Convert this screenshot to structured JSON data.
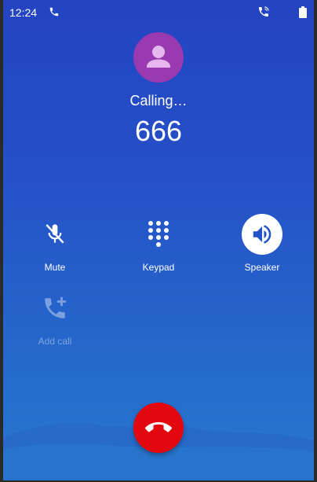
{
  "status_bar": {
    "time": "12:24",
    "icons": [
      "phone-icon",
      "wifi-calling-icon",
      "battery-icon"
    ]
  },
  "call": {
    "status": "Calling…",
    "number": "666"
  },
  "actions": {
    "mute": {
      "label": "Mute",
      "icon": "mic-off-icon"
    },
    "keypad": {
      "label": "Keypad",
      "icon": "dialpad-icon"
    },
    "speaker": {
      "label": "Speaker",
      "icon": "speaker-icon"
    },
    "add_call": {
      "label": "Add call",
      "icon": "add-call-icon",
      "enabled": false
    }
  },
  "end_call": {
    "icon": "end-call-icon"
  },
  "colors": {
    "background_top": "#2444c2",
    "background_bottom": "#2679cf",
    "avatar": "#9a3ab1",
    "end_call": "#e3070e"
  }
}
